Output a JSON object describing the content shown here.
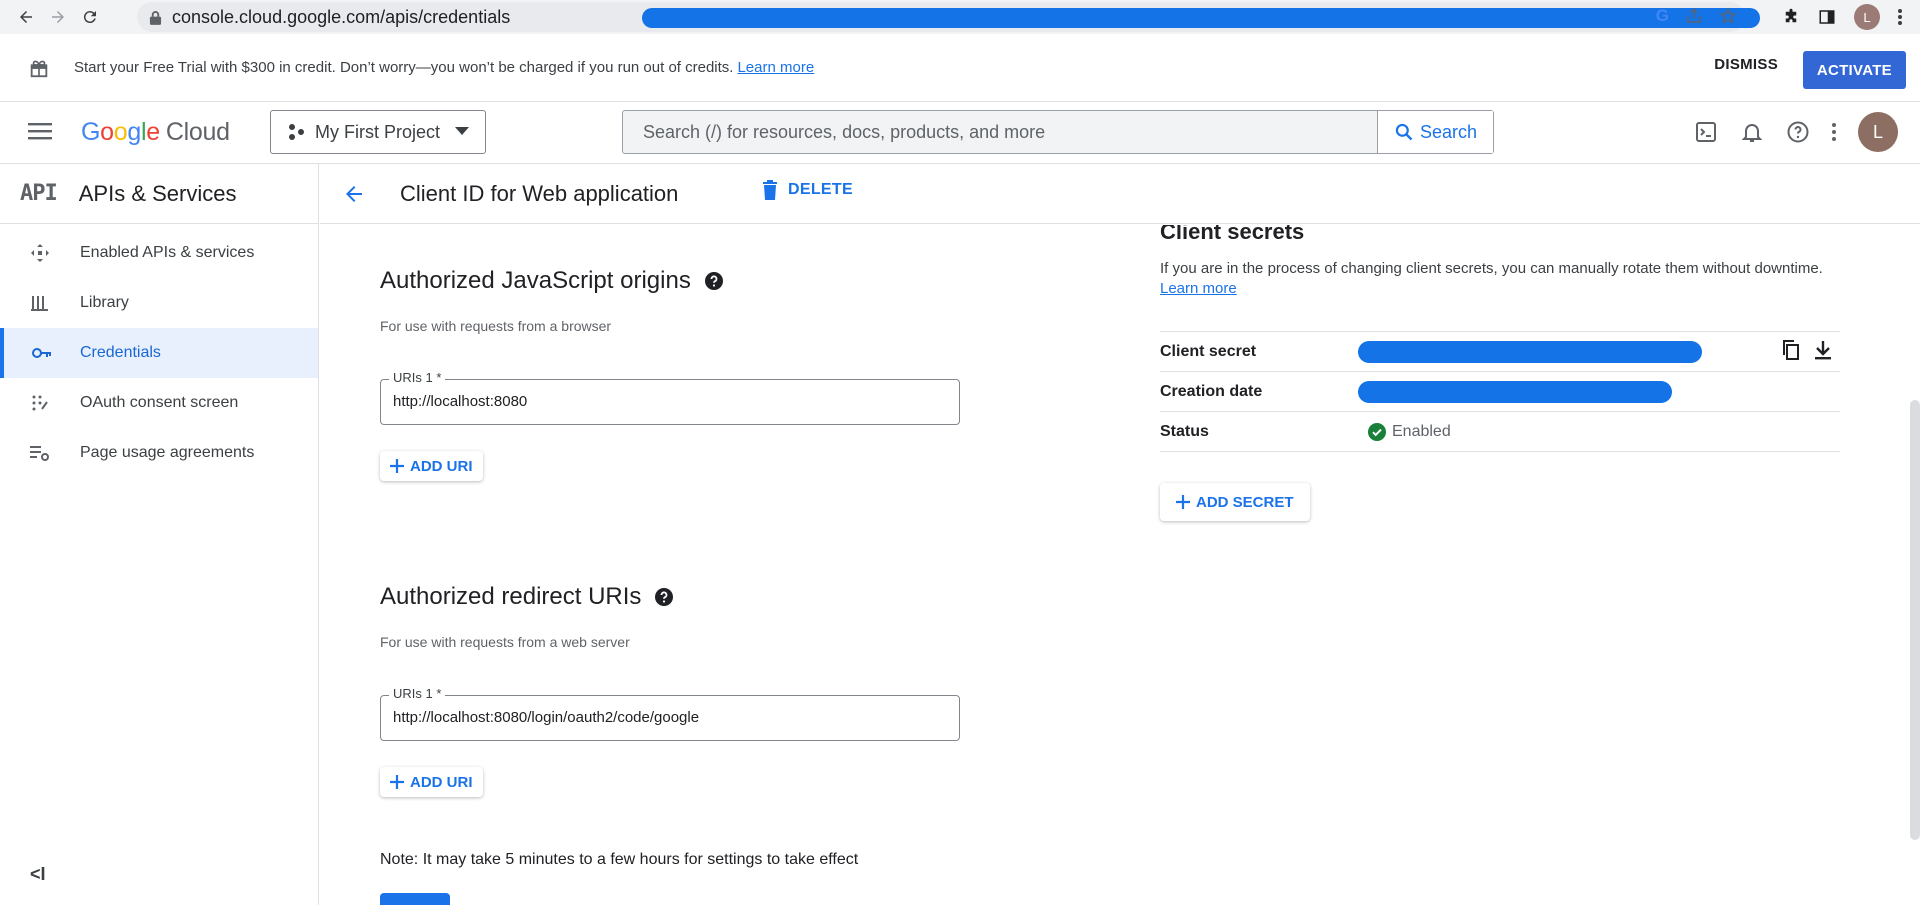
{
  "browser": {
    "url": "console.cloud.google.com/apis/credentials",
    "avatar_letter": "L"
  },
  "banner": {
    "message": "Start your Free Trial with $300 in credit. Don’t worry—you won’t be charged if you run out of credits.",
    "learn_more": "Learn more",
    "dismiss": "DISMISS",
    "activate": "ACTIVATE"
  },
  "appbar": {
    "logo_google": [
      "G",
      "o",
      "o",
      "g",
      "l",
      "e"
    ],
    "logo_cloud": "Cloud",
    "project": "My First Project",
    "search_placeholder": "Search (/) for resources, docs, products, and more",
    "search_button": "Search",
    "avatar_letter": "L"
  },
  "sidebar": {
    "api_badge": "API",
    "title": "APIs & Services",
    "items": [
      {
        "label": "Enabled APIs & services",
        "icon": "diamond-arrows-icon"
      },
      {
        "label": "Library",
        "icon": "library-icon"
      },
      {
        "label": "Credentials",
        "icon": "key-icon",
        "active": true
      },
      {
        "label": "OAuth consent screen",
        "icon": "dots-grid-icon"
      },
      {
        "label": "Page usage agreements",
        "icon": "list-settings-icon"
      }
    ],
    "collapse": "<I"
  },
  "header": {
    "title": "Client ID for Web application",
    "delete": "DELETE"
  },
  "js_origins": {
    "title": "Authorized JavaScript origins",
    "subtitle": "For use with requests from a browser",
    "field_label": "URIs 1 *",
    "field_value": "http://localhost:8080",
    "add_button": "ADD URI"
  },
  "redirect_uris": {
    "title": "Authorized redirect URIs",
    "subtitle": "For use with requests from a web server",
    "field_label": "URIs 1 *",
    "field_value": "http://localhost:8080/login/oauth2/code/google",
    "add_button": "ADD URI"
  },
  "note": "Note: It may take 5 minutes to a few hours for settings to take effect",
  "client_secrets": {
    "title": "Client secrets",
    "description": "If you are in the process of changing client secrets, you can manually rotate them without downtime.",
    "learn_more": "Learn more",
    "rows": {
      "secret_label": "Client secret",
      "creation_label": "Creation date",
      "status_label": "Status",
      "status_value": "Enabled"
    },
    "add_button": "ADD SECRET"
  },
  "colors": {
    "accent": "#1a73e8",
    "redaction": "#1473e6",
    "success": "#188038"
  }
}
